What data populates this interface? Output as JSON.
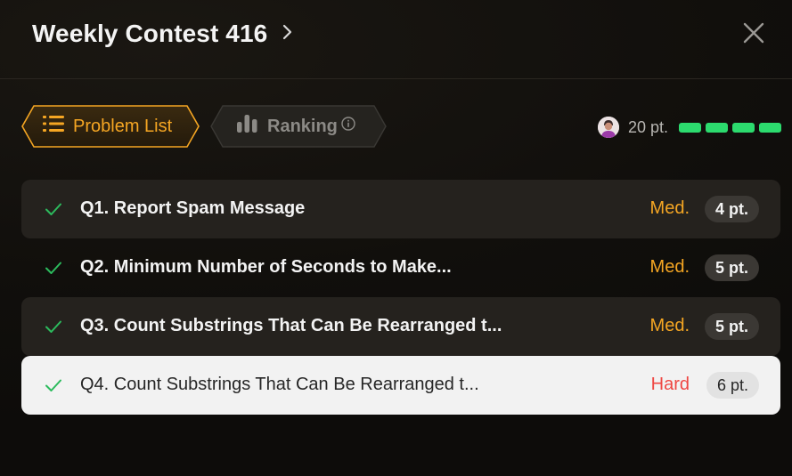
{
  "header": {
    "title": "Weekly Contest 416"
  },
  "tabs": [
    {
      "label": "Problem List",
      "icon": "list-icon",
      "active": true
    },
    {
      "label": "Ranking",
      "icon": "bar-chart-icon",
      "info_icon": "info-icon",
      "active": false
    }
  ],
  "user": {
    "score_label": "20 pt.",
    "progress_segments_filled": 4,
    "progress_segments_total": 4,
    "progress_color": "#2cdb6e"
  },
  "colors": {
    "accent": "#f5a623",
    "medium": "#f5a623",
    "hard": "#ef4743",
    "solved_check": "#2cbb5d"
  },
  "problems": [
    {
      "title": "Q1. Report Spam Message",
      "difficulty": "Med.",
      "points": "4 pt.",
      "solved": true
    },
    {
      "title": "Q2. Minimum Number of Seconds to Make...",
      "difficulty": "Med.",
      "points": "5 pt.",
      "solved": true
    },
    {
      "title": "Q3. Count Substrings That Can Be Rearranged t...",
      "difficulty": "Med.",
      "points": "5 pt.",
      "solved": true
    },
    {
      "title": "Q4. Count Substrings That Can Be Rearranged t...",
      "difficulty": "Hard",
      "points": "6 pt.",
      "solved": true
    }
  ]
}
